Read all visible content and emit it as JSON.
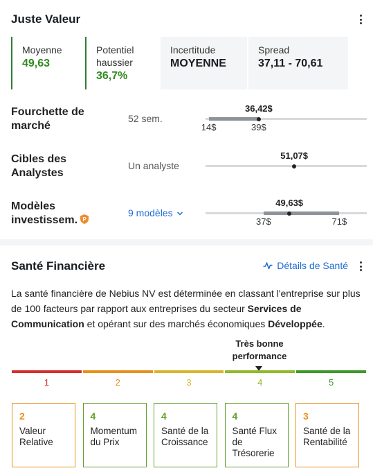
{
  "fair_value": {
    "title": "Juste Valeur",
    "cards": [
      {
        "label": "Moyenne",
        "value": "49,63"
      },
      {
        "label": "Potentiel haussier",
        "value": "36,7%"
      },
      {
        "label": "Incertitude",
        "value": "MOYENNE"
      },
      {
        "label": "Spread",
        "value": "37,11 - 70,61"
      }
    ],
    "ranges": [
      {
        "title": "Fourchette de marché",
        "sub": "52 sem.",
        "top": "36,42$",
        "low": "14$",
        "high": "39$",
        "position": 0.33,
        "band_start": 0.02,
        "band_end": 0.33
      },
      {
        "title": "Cibles des Analystes",
        "sub": "Un analyste",
        "top": "51,07$",
        "position": 0.55
      },
      {
        "title": "Modèles investissem.",
        "sub": "9 modèles",
        "top": "49,63$",
        "low": "37$",
        "high": "71$",
        "position": 0.52,
        "band_start": 0.36,
        "band_end": 0.83
      }
    ]
  },
  "health": {
    "title": "Santé Financière",
    "details_link": "Détails de Santé",
    "para_1": "La santé financière de Nebius NV est déterminée en classant l'entreprise sur plus de 100 facteurs par rapport aux entreprises du secteur ",
    "para_sector": "Services de Communication",
    "para_2": " et opérant sur des marchés économiques ",
    "para_market": "Développée",
    "para_3": ".",
    "perf_label_1": "Très bonne",
    "perf_label_2": "performance",
    "scale": [
      "1",
      "2",
      "3",
      "4",
      "5"
    ],
    "scale_colors": [
      "#d32f2f",
      "#e8901c",
      "#d9b52a",
      "#8fba2b",
      "#3d9a2a"
    ],
    "score": 4,
    "cards": [
      {
        "score": "2",
        "name": "Valeur Relative",
        "color": "#e8901c"
      },
      {
        "score": "4",
        "name": "Momentum du Prix",
        "color": "#5ea12a"
      },
      {
        "score": "4",
        "name": "Santé de la Croissance",
        "color": "#5ea12a"
      },
      {
        "score": "4",
        "name": "Santé Flux de Trésorerie",
        "color": "#5ea12a"
      },
      {
        "score": "3",
        "name": "Santé de la Rentabilité",
        "color": "#e8901c"
      }
    ]
  }
}
